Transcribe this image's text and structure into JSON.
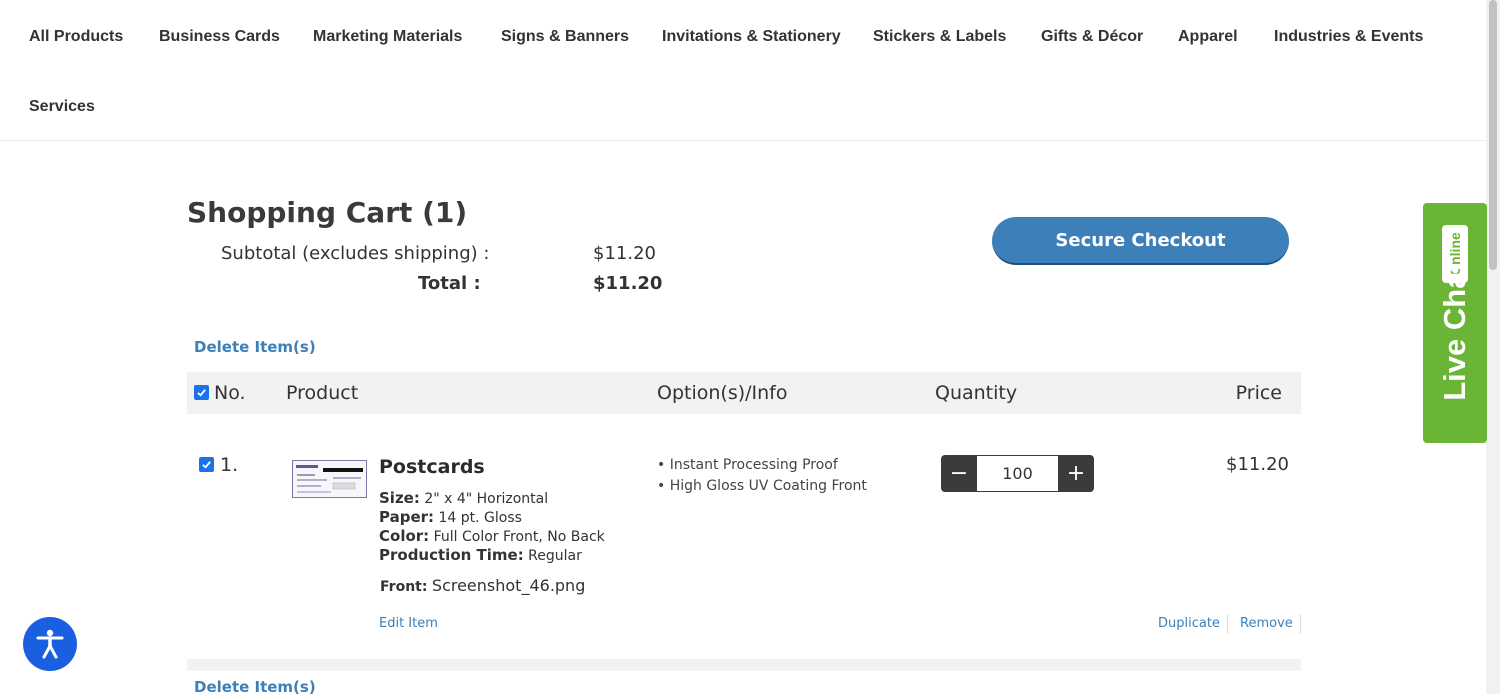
{
  "nav": {
    "items": [
      "All Products",
      "Business Cards",
      "Marketing Materials",
      "Signs & Banners",
      "Invitations & Stationery",
      "Stickers & Labels",
      "Gifts & Décor",
      "Apparel",
      "Industries & Events",
      "Services"
    ]
  },
  "cart": {
    "title": "Shopping Cart (1)",
    "subtotal_label": "Subtotal (excludes shipping) :",
    "subtotal_value": "$11.20",
    "total_label": "Total :",
    "total_value": "$11.20",
    "checkout_label": "Secure Checkout",
    "delete_label": "Delete Item(s)"
  },
  "table": {
    "headers": {
      "no": "No.",
      "product": "Product",
      "options": "Option(s)/Info",
      "quantity": "Quantity",
      "price": "Price"
    },
    "rows": [
      {
        "number": "1.",
        "product_name": "Postcards",
        "specs": [
          {
            "label": "Size:",
            "value": "2\" x 4\" Horizontal"
          },
          {
            "label": "Paper:",
            "value": "14 pt. Gloss"
          },
          {
            "label": "Color:",
            "value": "Full Color Front, No Back"
          },
          {
            "label": "Production Time:",
            "value": "Regular"
          }
        ],
        "front_label": "Front:",
        "front_file": "Screenshot_46.png",
        "options": [
          "• Instant Processing Proof",
          "• High Gloss UV Coating Front"
        ],
        "quantity": "100",
        "price": "$11.20",
        "edit_label": "Edit Item",
        "duplicate_label": "Duplicate",
        "remove_label": "Remove"
      }
    ]
  },
  "qty_controls": {
    "minus": "−",
    "plus": "+"
  },
  "live_chat": {
    "label": "Live Chat",
    "badge": "Online"
  },
  "colors": {
    "accent": "#3d7fb8",
    "chat_green": "#6bb536",
    "a11y_blue": "#1a5fe0"
  },
  "icons": {
    "accessibility": "accessibility-icon",
    "checkbox": "checkbox-checked-icon"
  }
}
